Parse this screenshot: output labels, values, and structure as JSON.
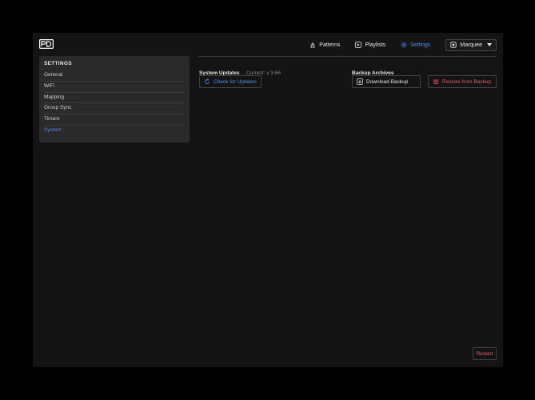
{
  "nav": {
    "patterns": "Patterns",
    "playlists": "Playlists",
    "settings": "Settings",
    "device": "Marquee"
  },
  "sidebar": {
    "title": "SETTINGS",
    "items": [
      {
        "label": "General"
      },
      {
        "label": "WiFi"
      },
      {
        "label": "Mapping"
      },
      {
        "label": "Group Sync"
      },
      {
        "label": "Timers"
      },
      {
        "label": "System"
      }
    ],
    "active": "System"
  },
  "updates": {
    "title": "System Updates",
    "current": "· Current: v 3.66",
    "check_label": "Check for Updates"
  },
  "backup": {
    "title": "Backup Archives",
    "download_label": "Download Backup",
    "restore_label": "Restore from Backup"
  },
  "restart_label": "Restart",
  "colors": {
    "accent": "#4e8ef0",
    "danger": "#e8595c",
    "background": "#141414",
    "panel": "#2a2a2a"
  }
}
